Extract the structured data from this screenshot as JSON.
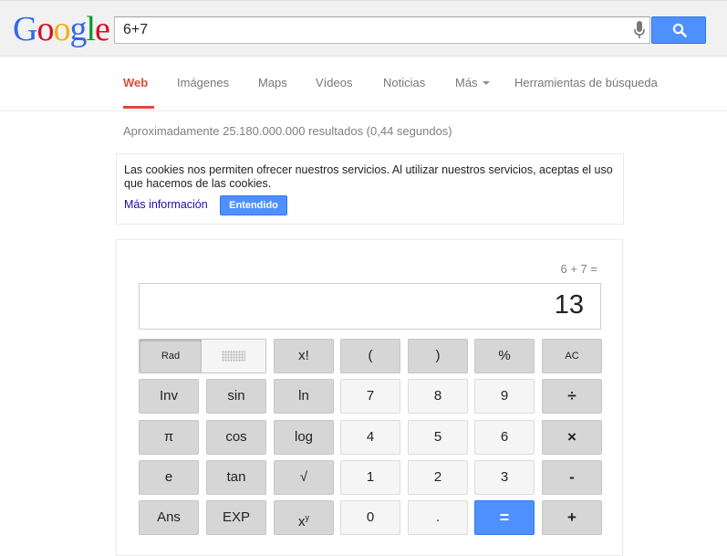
{
  "logo": {
    "letters": [
      {
        "char": "G",
        "color": "#3369e8"
      },
      {
        "char": "o",
        "color": "#d50f25"
      },
      {
        "char": "o",
        "color": "#eeb211"
      },
      {
        "char": "g",
        "color": "#3369e8"
      },
      {
        "char": "l",
        "color": "#009925"
      },
      {
        "char": "e",
        "color": "#d50f25"
      }
    ]
  },
  "search": {
    "value": "6+7",
    "button_icon": "search-icon",
    "voice_icon": "mic-icon"
  },
  "tabs": [
    {
      "label": "Web",
      "active": true
    },
    {
      "label": "Imágenes"
    },
    {
      "label": "Maps"
    },
    {
      "label": "Vídeos"
    },
    {
      "label": "Noticias"
    },
    {
      "label": "Más",
      "dropdown": true
    },
    {
      "label": "Herramientas de búsqueda"
    }
  ],
  "result_stats": "Aproximadamente 25.180.000.000 resultados (0,44 segundos)",
  "cookie_notice": {
    "text": "Las cookies nos permiten ofrecer nuestros servicios. Al utilizar nuestros servicios, aceptas el uso que hacemos de las cookies.",
    "more_link": "Más información",
    "accept_button": "Entendido"
  },
  "calculator": {
    "history": "6 + 7 =",
    "result": "13",
    "mode_label": "Rad",
    "keys": {
      "row1": [
        "x!",
        "(",
        ")",
        "%",
        "AC"
      ],
      "row2": [
        "Inv",
        "sin",
        "ln",
        "7",
        "8",
        "9",
        "÷"
      ],
      "row3": [
        "π",
        "cos",
        "log",
        "4",
        "5",
        "6",
        "×"
      ],
      "row4": [
        "e",
        "tan",
        "√",
        "1",
        "2",
        "3",
        "-"
      ],
      "row5": [
        "Ans",
        "EXP",
        "x",
        "0",
        ".",
        "=",
        "+"
      ],
      "power_superscript": "y"
    }
  },
  "colors": {
    "accent_blue": "#4d90fe",
    "active_tab_red": "#dd4b39"
  }
}
